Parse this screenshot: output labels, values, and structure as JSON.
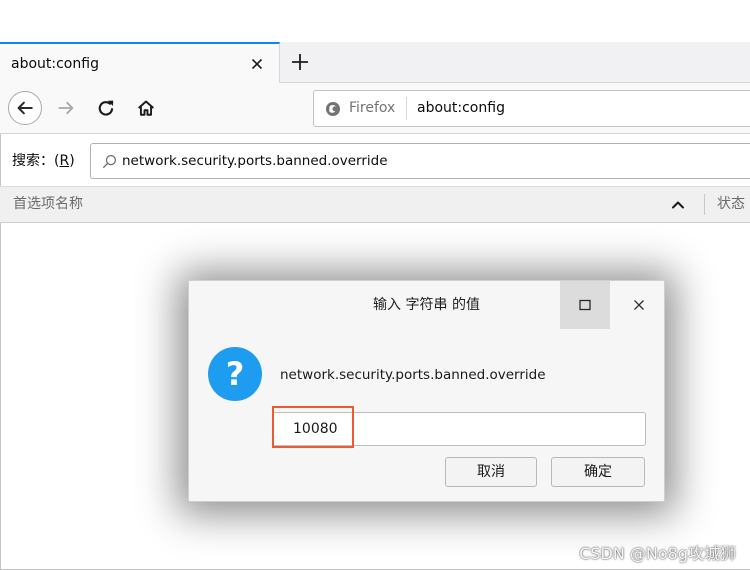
{
  "browser": {
    "tab": {
      "title": "about:config",
      "close_icon": "close-icon"
    },
    "new_tab_icon": "plus-icon"
  },
  "nav": {
    "back_icon": "back-arrow-icon",
    "forward_icon": "forward-arrow-icon",
    "reload_icon": "reload-icon",
    "home_icon": "home-icon"
  },
  "url_bar": {
    "identity_icon": "firefox-icon",
    "identity_label": "Firefox",
    "url": "about:config"
  },
  "search": {
    "label": "搜索：",
    "accesskey_open": "(",
    "accesskey": "R",
    "accesskey_close": ")",
    "icon": "search-icon",
    "value": "network.security.ports.banned.override"
  },
  "columns": {
    "name": "首选项名称",
    "sort_icon": "chevron-up-icon",
    "status": "状态"
  },
  "dialog": {
    "title": "输入 字符串 的值",
    "maximize_icon": "maximize-icon",
    "close_icon": "close-icon",
    "icon": "question-icon",
    "icon_glyph": "?",
    "message": "network.security.ports.banned.override",
    "input_value": "10080",
    "cancel_label": "取消",
    "ok_label": "确定"
  },
  "watermark": "CSDN @No8g攻城狮",
  "colors": {
    "accent": "#0a84ff",
    "question_icon": "#1e9cf0",
    "highlight": "#ee5a2e"
  }
}
